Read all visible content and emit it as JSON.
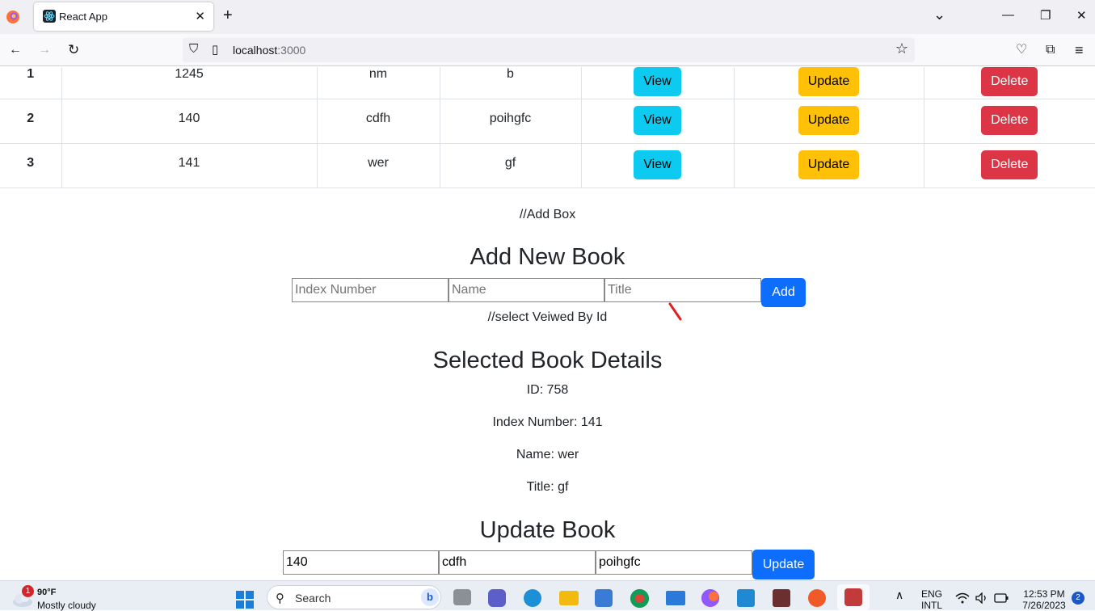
{
  "browser": {
    "tab_title": "React App",
    "new_tab": "+",
    "url_host": "localhost",
    "url_port": ":3000",
    "close_tab": "✕",
    "minimize": "—",
    "restore": "❐",
    "close_window": "✕",
    "tab_list": "⌄",
    "back": "←",
    "forward": "→",
    "reload": "↻",
    "shield_icon": "⛉",
    "page_icon": "▯",
    "star": "☆",
    "pocket": "♡",
    "extensions": "⧉",
    "menu": "≡"
  },
  "table": {
    "rows": [
      {
        "num": "1",
        "index": "1245",
        "name": "nm",
        "title": "b"
      },
      {
        "num": "2",
        "index": "140",
        "name": "cdfh",
        "title": "poihgfc"
      },
      {
        "num": "3",
        "index": "141",
        "name": "wer",
        "title": "gf"
      }
    ],
    "view_label": "View",
    "update_label": "Update",
    "delete_label": "Delete"
  },
  "add_section": {
    "comment": "//Add Box",
    "heading": "Add New Book",
    "index_placeholder": "Index Number",
    "name_placeholder": "Name",
    "title_placeholder": "Title",
    "add_label": "Add"
  },
  "selected_section": {
    "comment": "//select Veiwed By Id",
    "heading": "Selected Book Details",
    "id_line": "ID: 758",
    "index_line": "Index Number: 141",
    "name_line": "Name: wer",
    "title_line": "Title: gf"
  },
  "update_section": {
    "heading": "Update Book",
    "index_value": "140",
    "name_value": "cdfh",
    "title_value": "poihgfc",
    "update_label": "Update"
  },
  "taskbar": {
    "weather_badge": "1",
    "temperature": "90°F",
    "weather_desc": "Mostly cloudy",
    "search_label": "Search",
    "language_1": "ENG",
    "language_2": "INTL",
    "time": "12:53 PM",
    "date": "7/26/2023",
    "notifications": "2",
    "tray_chevron": "∧"
  },
  "colors": {
    "view": "#0dcaf0",
    "update": "#ffc107",
    "delete": "#dc3545",
    "primary": "#0d6efd"
  }
}
